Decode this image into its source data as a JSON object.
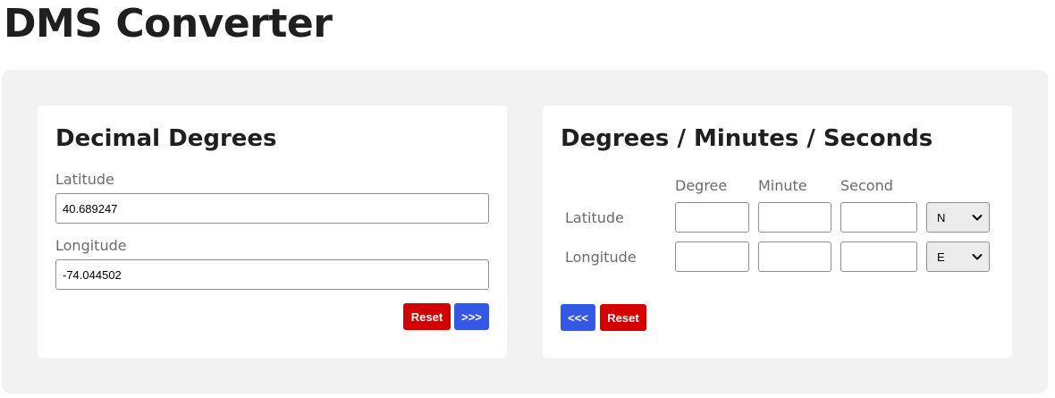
{
  "page": {
    "title": "DMS Converter"
  },
  "decimal": {
    "title": "Decimal Degrees",
    "latitude_label": "Latitude",
    "latitude_value": "40.689247",
    "longitude_label": "Longitude",
    "longitude_value": "-74.044502",
    "reset_label": "Reset",
    "convert_label": ">>>"
  },
  "dms": {
    "title": "Degrees / Minutes / Seconds",
    "headers": {
      "degree": "Degree",
      "minute": "Minute",
      "second": "Second"
    },
    "latitude": {
      "label": "Latitude",
      "degree": "",
      "minute": "",
      "second": "",
      "direction": "N"
    },
    "longitude": {
      "label": "Longitude",
      "degree": "",
      "minute": "",
      "second": "",
      "direction": "E"
    },
    "convert_back_label": "<<<",
    "reset_label": "Reset"
  },
  "colors": {
    "reset_button": "#d40000",
    "convert_button": "#3358e6",
    "panel_background": "#f2f2f2"
  },
  "icons": {
    "select_arrow": "chevron-down-icon"
  }
}
